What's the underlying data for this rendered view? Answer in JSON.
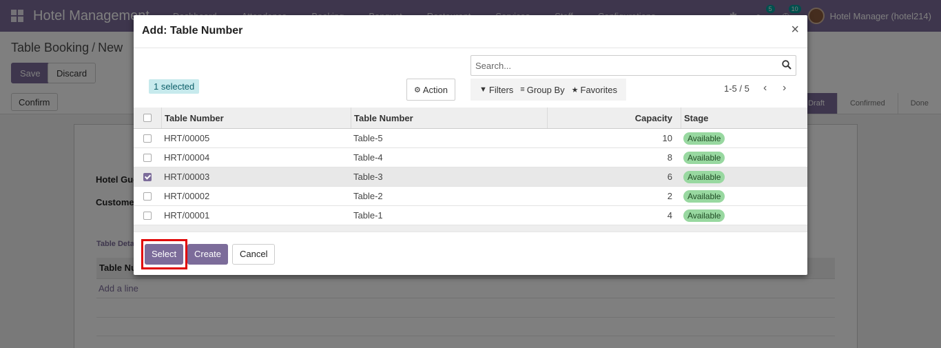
{
  "navbar": {
    "app_title": "Hotel Management",
    "menu": [
      "Dashboard",
      "Attendance",
      "Booking",
      "Banquet",
      "Restaurant",
      "Services",
      "Staff",
      "Configurations"
    ],
    "messages_badge": "5",
    "activity_badge": "10",
    "user": "Hotel Manager (hotel214)"
  },
  "control_panel": {
    "breadcrumb_parent": "Table Booking",
    "breadcrumb_current": "New",
    "save_label": "Save",
    "discard_label": "Discard",
    "confirm_label": "Confirm",
    "stages": [
      "Draft",
      "Confirmed",
      "Done"
    ]
  },
  "form": {
    "guest_label": "Hotel Gue",
    "customer_label": "Custome",
    "section_title": "Table Deta",
    "table_column": "Table Nu",
    "add_line": "Add a line"
  },
  "dialog": {
    "title": "Add: Table Number",
    "close_label": "×",
    "search_placeholder": "Search...",
    "selected_badge": "1 selected",
    "action_label": "Action",
    "filters_label": "Filters",
    "group_by_label": "Group By",
    "favorites_label": "Favorites",
    "pager": "1-5 / 5",
    "columns": [
      "Table Number",
      "Table Number",
      "Capacity",
      "Stage"
    ],
    "rows": [
      {
        "code": "HRT/00005",
        "name": "Table-5",
        "capacity": "10",
        "stage": "Available",
        "checked": false
      },
      {
        "code": "HRT/00004",
        "name": "Table-4",
        "capacity": "8",
        "stage": "Available",
        "checked": false
      },
      {
        "code": "HRT/00003",
        "name": "Table-3",
        "capacity": "6",
        "stage": "Available",
        "checked": true
      },
      {
        "code": "HRT/00002",
        "name": "Table-2",
        "capacity": "2",
        "stage": "Available",
        "checked": false
      },
      {
        "code": "HRT/00001",
        "name": "Table-1",
        "capacity": "4",
        "stage": "Available",
        "checked": false
      }
    ],
    "select_label": "Select",
    "create_label": "Create",
    "cancel_label": "Cancel"
  },
  "colors": {
    "brand": "#7c6c9a",
    "stage_badge": "#98d8a0",
    "highlight": "#e00000"
  }
}
